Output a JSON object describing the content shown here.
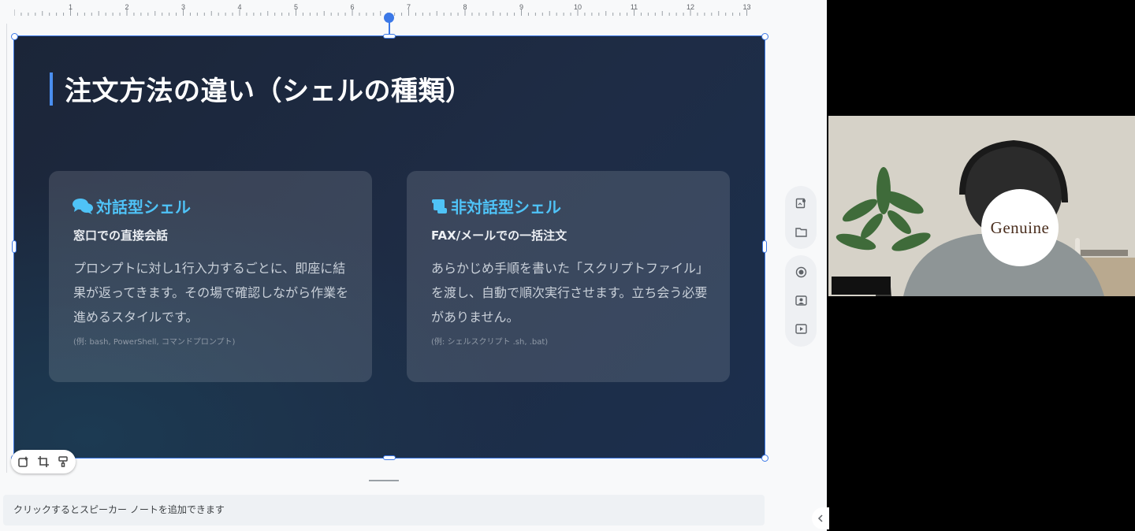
{
  "ruler": {
    "marks": [
      "1",
      "2",
      "3",
      "4",
      "5",
      "6",
      "7",
      "8",
      "9",
      "10",
      "11",
      "12",
      "13"
    ]
  },
  "slide": {
    "title": "注文方法の違い（シェルの種類）",
    "cards": [
      {
        "icon": "chat-bubbles-icon",
        "heading": "対話型シェル",
        "subheading": "窓口での直接会話",
        "body": "プロンプトに対し1行入力するごとに、即座に結果が返ってきます。その場で確認しながら作業を進めるスタイルです。",
        "note": "(例: bash, PowerShell, コマンドプロンプト)"
      },
      {
        "icon": "scroll-icon",
        "heading": "非対話型シェル",
        "subheading": "FAX/メールでの一括注文",
        "body": "あらかじめ手順を書いた「スクリプトファイル」を渡し、自動で順次実行させます。立ち会う必要がありません。",
        "note": "(例: シェルスクリプト .sh, .bat)"
      }
    ]
  },
  "notes": {
    "placeholder": "クリックするとスピーカー ノートを追加できます"
  },
  "video": {
    "logo": "Genuine"
  },
  "colors": {
    "accent": "#4fc3f7",
    "selection": "#3b78e7",
    "slide_bg": "#1e2c45"
  }
}
